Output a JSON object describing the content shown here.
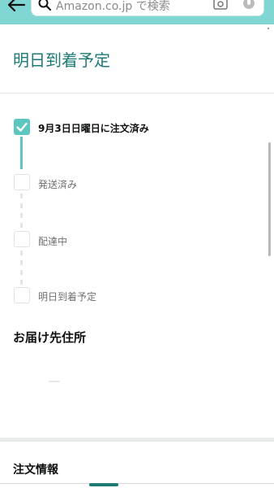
{
  "search": {
    "placeholder_text": "Amazon.co.jp で検索"
  },
  "page": {
    "title": "明日到着予定"
  },
  "timeline": {
    "steps": [
      {
        "label": "9月3日日曜日に注文済み",
        "completed": true
      },
      {
        "label": "発送済み",
        "completed": false
      },
      {
        "label": "配達中",
        "completed": false
      },
      {
        "label": "明日到着予定",
        "completed": false
      }
    ]
  },
  "shipping": {
    "heading": "お届け先住所"
  },
  "order": {
    "heading": "注文情報"
  },
  "colors": {
    "header_bg": "#7fd6d3",
    "accent": "#1d7a74",
    "progress": "#5cc7c1"
  }
}
